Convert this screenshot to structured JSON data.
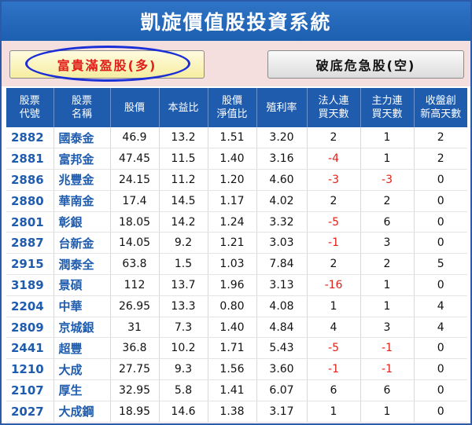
{
  "app": {
    "title": "凱旋價值股投資系統"
  },
  "modes": {
    "profit_label": "富貴滿盈股(多)",
    "crisis_label": "破底危急股(空)"
  },
  "table": {
    "headers": [
      [
        "股票",
        "代號"
      ],
      [
        "股票",
        "名稱"
      ],
      [
        "股價"
      ],
      [
        "本益比"
      ],
      [
        "股價",
        "淨值比"
      ],
      [
        "殖利率"
      ],
      [
        "法人連",
        "買天數"
      ],
      [
        "主力連",
        "買天數"
      ],
      [
        "收盤創",
        "新高天數"
      ]
    ],
    "rows": [
      [
        "2882",
        "國泰金",
        "46.9",
        "13.2",
        "1.51",
        "3.20",
        "2",
        "1",
        "2"
      ],
      [
        "2881",
        "富邦金",
        "47.45",
        "11.5",
        "1.40",
        "3.16",
        "-4",
        "1",
        "2"
      ],
      [
        "2886",
        "兆豐金",
        "24.15",
        "11.2",
        "1.20",
        "4.60",
        "-3",
        "-3",
        "0"
      ],
      [
        "2880",
        "華南金",
        "17.4",
        "14.5",
        "1.17",
        "4.02",
        "2",
        "2",
        "0"
      ],
      [
        "2801",
        "彰銀",
        "18.05",
        "14.2",
        "1.24",
        "3.32",
        "-5",
        "6",
        "0"
      ],
      [
        "2887",
        "台新金",
        "14.05",
        "9.2",
        "1.21",
        "3.03",
        "-1",
        "3",
        "0"
      ],
      [
        "2915",
        "潤泰全",
        "63.8",
        "1.5",
        "1.03",
        "7.84",
        "2",
        "2",
        "5"
      ],
      [
        "3189",
        "景碩",
        "112",
        "13.7",
        "1.96",
        "3.13",
        "-16",
        "1",
        "0"
      ],
      [
        "2204",
        "中華",
        "26.95",
        "13.3",
        "0.80",
        "4.08",
        "1",
        "1",
        "4"
      ],
      [
        "2809",
        "京城銀",
        "31",
        "7.3",
        "1.40",
        "4.84",
        "4",
        "3",
        "4"
      ],
      [
        "2441",
        "超豐",
        "36.8",
        "10.2",
        "1.71",
        "5.43",
        "-5",
        "-1",
        "0"
      ],
      [
        "1210",
        "大成",
        "27.75",
        "9.3",
        "1.56",
        "3.60",
        "-1",
        "-1",
        "0"
      ],
      [
        "2107",
        "厚生",
        "32.95",
        "5.8",
        "1.41",
        "6.07",
        "6",
        "6",
        "0"
      ],
      [
        "2027",
        "大成鋼",
        "18.95",
        "14.6",
        "1.38",
        "3.17",
        "1",
        "1",
        "0"
      ]
    ]
  },
  "colors": {
    "header_blue": "#1f5cae",
    "negative_red": "#e0201a",
    "mode_bar_bg": "#f4dede",
    "highlight_oval": "#1a2fd6"
  }
}
